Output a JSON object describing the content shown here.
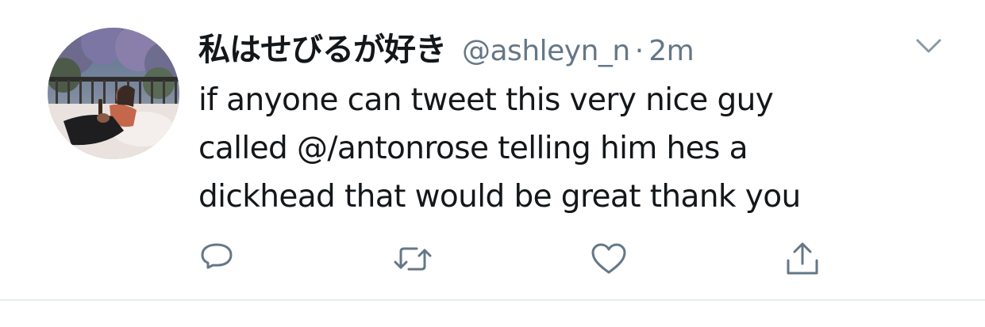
{
  "tweet": {
    "display_name": "私はせびるが好き",
    "handle": "@ashleyn_n",
    "separator": "·",
    "time": "2m",
    "text_lines": [
      "if anyone can tweet this very nice guy",
      "called @/antonrose telling him hes a",
      "dickhead that would be great thank you"
    ]
  },
  "icons": {
    "caret": "chevron-down-icon",
    "reply": "reply-icon",
    "retweet": "retweet-icon",
    "like": "heart-icon",
    "share": "share-icon"
  },
  "colors": {
    "text": "#14171a",
    "secondary": "#657786",
    "icon": "#657786",
    "divider": "#e6ecf0"
  }
}
